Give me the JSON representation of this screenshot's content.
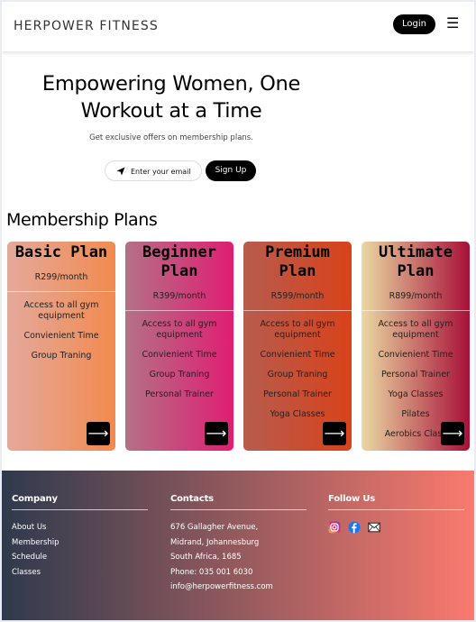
{
  "header": {
    "brand": "HERPOWER FITNESS",
    "login_label": "Login",
    "menu_icon": "☰"
  },
  "hero": {
    "title_line1": "Empowering Women, One",
    "title_line2": "Workout at a Time",
    "subtitle": "Get exclusive offers on membership plans.",
    "email_placeholder": "Enter your email",
    "signup_label": "Sign Up"
  },
  "plans": {
    "heading": "Membership Plans",
    "arrow": "⟶",
    "items": [
      {
        "title": "Basic Plan",
        "price": "R299/month",
        "features": [
          "Access to all gym equipment",
          "Convienient Time",
          "Group Traning"
        ]
      },
      {
        "title": "Beginner Plan",
        "price": "R399/month",
        "features": [
          "Access to all gym equipment",
          "Convienient Time",
          "Group Traning",
          "Personal Trainer"
        ]
      },
      {
        "title": "Premium Plan",
        "price": "R599/month",
        "features": [
          "Access to all gym equipment",
          "Convienient Time",
          "Group Traning",
          "Personal Trainer",
          "Yoga Classes"
        ]
      },
      {
        "title": "Ultimate Plan",
        "price": "R899/month",
        "features": [
          "Access to all gym equipment",
          "Convienient Time",
          "Personal Trainer",
          "Yoga Classes",
          "Pilates",
          "Aerobics Class"
        ]
      }
    ]
  },
  "footer": {
    "company": {
      "heading": "Company",
      "links": [
        "About Us",
        "Membership",
        "Schedule",
        "Classes"
      ]
    },
    "contacts": {
      "heading": "Contacts",
      "lines": [
        "676 Gallagher Avenue,",
        "Midrand, Johannesburg",
        "South Africa, 1685",
        "Phone: 035 001 6030",
        "info@herpowerfitness.com"
      ]
    },
    "follow": {
      "heading": "Follow Us",
      "icons": [
        "instagram-icon",
        "facebook-icon",
        "mail-icon"
      ]
    }
  }
}
